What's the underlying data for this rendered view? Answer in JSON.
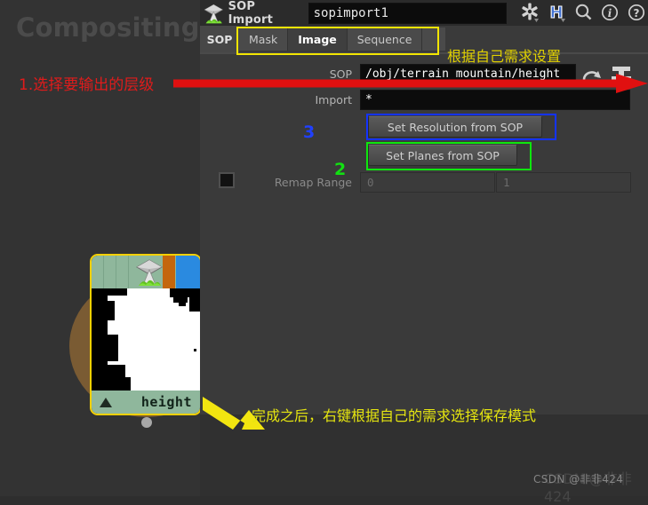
{
  "network": {
    "title": "Compositing",
    "node": {
      "name": "height",
      "icon_name": "sop-import-node-icon",
      "flags": [
        "orange-flag",
        "blue-flag"
      ]
    }
  },
  "param_panel": {
    "type_icon": "sop-import-icon",
    "type_label": "SOP Import",
    "node_name_value": "sopimport1",
    "header_icons": [
      {
        "name": "gear-icon",
        "glyph": "⚙"
      },
      {
        "name": "houdini-h-icon",
        "glyph": "H"
      },
      {
        "name": "search-icon",
        "glyph": "⌕"
      },
      {
        "name": "info-icon",
        "glyph": "i"
      },
      {
        "name": "help-icon",
        "glyph": "?"
      }
    ],
    "tab_root": "SOP",
    "tabs": [
      {
        "label": "Mask",
        "active": false
      },
      {
        "label": "Image",
        "active": true
      },
      {
        "label": "Sequence",
        "active": false
      }
    ],
    "rows": {
      "sop": {
        "label": "SOP",
        "value": "/obj/terrain_mountain/height"
      },
      "import": {
        "label": "Import",
        "value": "*"
      },
      "set_resolution": {
        "label": "Set Resolution from SOP"
      },
      "set_planes": {
        "label": "Set Planes from SOP"
      },
      "remap_range": {
        "label": "Remap Range",
        "min": "0",
        "max": "1",
        "enabled": false
      }
    },
    "field_icons": [
      {
        "name": "reload-path-icon"
      },
      {
        "name": "node-chooser-icon"
      }
    ]
  },
  "annotations": {
    "step1": {
      "text": "1.选择要输出的层级",
      "color": "#e01b1b"
    },
    "top_right": {
      "text": "根据自己需求设置",
      "color": "#e0d000"
    },
    "bottom": {
      "text": "完成之后，右键根据自己的需求选择保存模式",
      "color": "#e5e510"
    },
    "num3": {
      "text": "3",
      "color": "#2040ff"
    },
    "num2": {
      "text": "2",
      "color": "#12e012"
    },
    "boxes": [
      {
        "name": "tabs-highlight-box",
        "color": "#f2e500"
      },
      {
        "name": "set-resolution-highlight-box",
        "color": "#1433ff"
      },
      {
        "name": "set-planes-highlight-box",
        "color": "#0ee60e"
      }
    ]
  },
  "watermark": {
    "text": "CSDN @非非424"
  }
}
